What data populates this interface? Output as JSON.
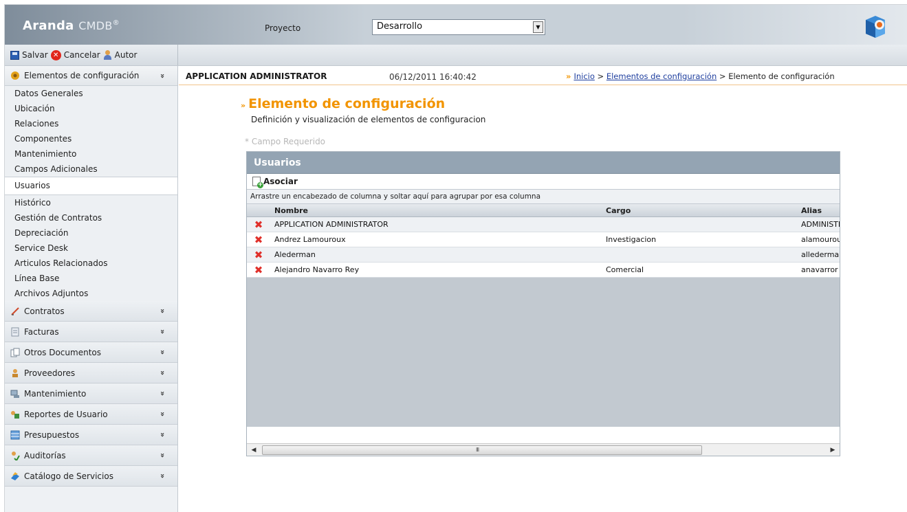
{
  "header": {
    "logo_brand": "Aranda",
    "logo_product": "CMDB",
    "logo_reg": "®",
    "project_label": "Proyecto",
    "project_value": "Desarrollo"
  },
  "toolbar": {
    "save_label": "Salvar",
    "cancel_label": "Cancelar",
    "author_label": "Autor"
  },
  "sidebar": {
    "open_section": {
      "label": "Elementos de configuración",
      "items": [
        "Datos Generales",
        "Ubicación",
        "Relaciones",
        "Componentes",
        "Mantenimiento",
        "Campos Adicionales",
        "Usuarios",
        "Histórico",
        "Gestión de Contratos",
        "Depreciación",
        "Service Desk",
        "Articulos Relacionados",
        "Línea Base",
        "Archivos Adjuntos"
      ],
      "active_item": "Usuarios"
    },
    "sections": [
      {
        "label": "Contratos",
        "icon": "pen-icon"
      },
      {
        "label": "Facturas",
        "icon": "invoice-icon"
      },
      {
        "label": "Otros Documentos",
        "icon": "documents-icon"
      },
      {
        "label": "Proveedores",
        "icon": "supplier-icon"
      },
      {
        "label": "Mantenimiento",
        "icon": "maintenance-icon"
      },
      {
        "label": "Reportes de Usuario",
        "icon": "reports-icon"
      },
      {
        "label": "Presupuestos",
        "icon": "budget-icon"
      },
      {
        "label": "Auditorías",
        "icon": "audit-icon"
      },
      {
        "label": "Catálogo de Servicios",
        "icon": "catalog-icon"
      }
    ]
  },
  "info_bar": {
    "user": "APPLICATION ADMINISTRATOR",
    "datetime": "06/12/2011 16:40:42",
    "breadcrumb_home": "Inicio",
    "breadcrumb_sep": ">",
    "breadcrumb_section": "Elementos de configuración",
    "breadcrumb_current": "Elemento de configuración"
  },
  "page": {
    "title": "Elemento de configuración",
    "description": "Definición y visualización de elementos de configuracion",
    "required_note": "* Campo Requerido"
  },
  "panel": {
    "title": "Usuarios",
    "associate_label": "Asociar",
    "group_hint": "Arrastre un encabezado de columna y soltar aquí para agrupar por esa columna",
    "columns": [
      "Nombre",
      "Cargo",
      "Alias"
    ],
    "rows": [
      {
        "nombre": "APPLICATION ADMINISTRATOR",
        "cargo": "",
        "alias": "ADMINISTR."
      },
      {
        "nombre": "Andrez Lamouroux",
        "cargo": "Investigacion",
        "alias": "alamouroux"
      },
      {
        "nombre": "Alederman",
        "cargo": "",
        "alias": "allederman"
      },
      {
        "nombre": "Alejandro Navarro Rey",
        "cargo": "Comercial",
        "alias": "anavarror"
      }
    ],
    "scroll_grip": "III"
  },
  "colors": {
    "accent_orange": "#f29400",
    "panel_header": "#94a4b3",
    "delete_red": "#e0302a",
    "link_blue": "#1e3e9e"
  }
}
